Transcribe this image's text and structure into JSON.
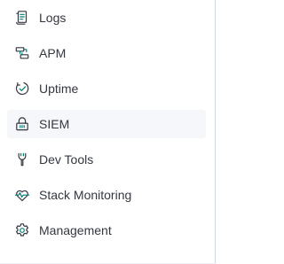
{
  "nav": {
    "items": [
      {
        "label": "Logs",
        "icon": "logs-icon",
        "active": false
      },
      {
        "label": "APM",
        "icon": "apm-icon",
        "active": false
      },
      {
        "label": "Uptime",
        "icon": "uptime-icon",
        "active": false
      },
      {
        "label": "SIEM",
        "icon": "siem-lock-icon",
        "active": true
      },
      {
        "label": "Dev Tools",
        "icon": "dev-tools-icon",
        "active": false
      },
      {
        "label": "Stack Monitoring",
        "icon": "stack-monitoring-icon",
        "active": false
      },
      {
        "label": "Management",
        "icon": "management-gear-icon",
        "active": false
      }
    ]
  },
  "colors": {
    "text": "#343741",
    "icon_dark": "#343741",
    "icon_accent": "#017d73",
    "active_bg": "#f5f7fa",
    "divider": "#d3dae6"
  }
}
